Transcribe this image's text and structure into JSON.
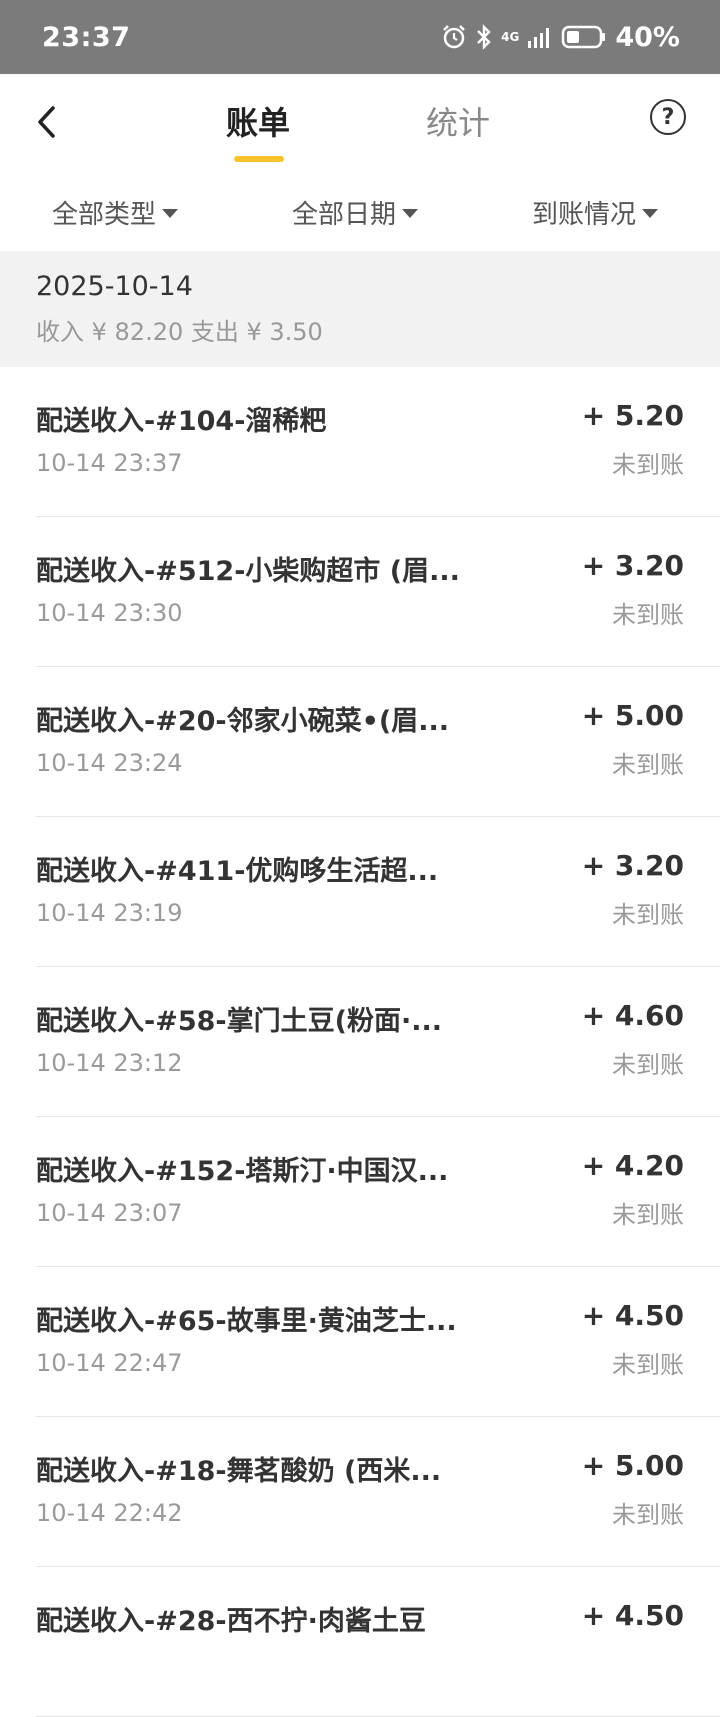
{
  "statusbar": {
    "time": "23:37",
    "network": "4G",
    "battery": "40%"
  },
  "nav": {
    "tab_bill": "账单",
    "tab_stats": "统计",
    "help": "?"
  },
  "filters": {
    "type": "全部类型",
    "date": "全部日期",
    "arrival": "到账情况"
  },
  "section": {
    "date": "2025-10-14",
    "summary": "收入 ¥ 82.20 支出 ¥ 3.50"
  },
  "items": [
    {
      "title": "配送收入-#104-溜稀粑",
      "time": "10-14 23:37",
      "amount": "+ 5.20",
      "status": "未到账"
    },
    {
      "title": "配送收入-#512-小柴购超市 (眉...",
      "time": "10-14 23:30",
      "amount": "+ 3.20",
      "status": "未到账"
    },
    {
      "title": "配送收入-#20-邻家小碗菜•(眉...",
      "time": "10-14 23:24",
      "amount": "+ 5.00",
      "status": "未到账"
    },
    {
      "title": "配送收入-#411-优购哆生活超...",
      "time": "10-14 23:19",
      "amount": "+ 3.20",
      "status": "未到账"
    },
    {
      "title": "配送收入-#58-掌门土豆(粉面·...",
      "time": "10-14 23:12",
      "amount": "+ 4.60",
      "status": "未到账"
    },
    {
      "title": "配送收入-#152-塔斯汀·中国汉...",
      "time": "10-14 23:07",
      "amount": "+ 4.20",
      "status": "未到账"
    },
    {
      "title": "配送收入-#65-故事里·黄油芝士...",
      "time": "10-14 22:47",
      "amount": "+ 4.50",
      "status": "未到账"
    },
    {
      "title": "配送收入-#18-舞茗酸奶 (西米...",
      "time": "10-14 22:42",
      "amount": "+ 5.00",
      "status": "未到账"
    },
    {
      "title": "配送收入-#28-西不拧·肉酱土豆",
      "time": "",
      "amount": "+ 4.50",
      "status": ""
    }
  ]
}
